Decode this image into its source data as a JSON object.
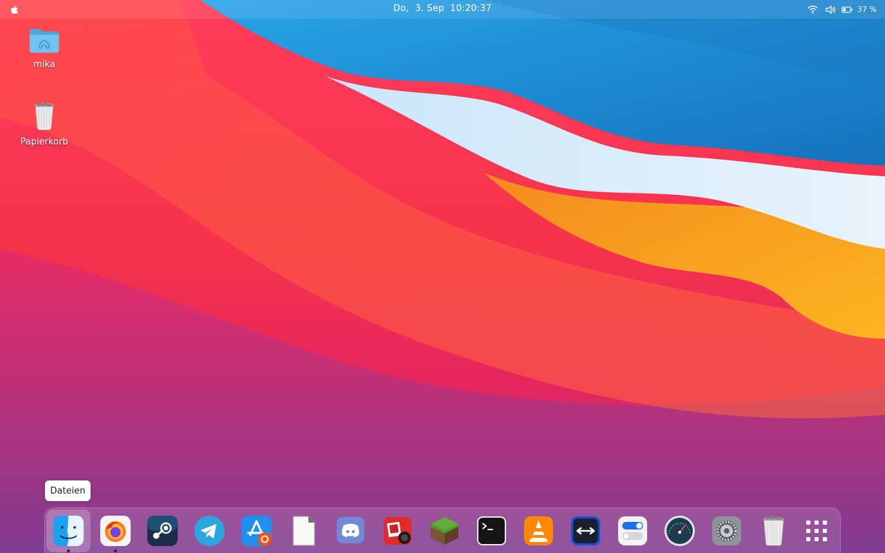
{
  "topbar": {
    "clock": "Do,  3. Sep  10:20:37",
    "battery_percent": "37 %"
  },
  "desktop": {
    "items": [
      {
        "label": "mika",
        "icon": "home-folder-icon"
      },
      {
        "label": "Papierkorb",
        "icon": "trash-icon"
      }
    ]
  },
  "dock": {
    "tooltip": "Dateien",
    "apps": [
      {
        "name": "finder",
        "icon": "finder-icon",
        "running": true,
        "active": true
      },
      {
        "name": "firefox",
        "icon": "firefox-icon",
        "running": true
      },
      {
        "name": "steam",
        "icon": "steam-icon"
      },
      {
        "name": "telegram",
        "icon": "telegram-icon"
      },
      {
        "name": "app-store",
        "icon": "app-store-icon"
      },
      {
        "name": "libreoffice",
        "icon": "document-icon"
      },
      {
        "name": "discord",
        "icon": "discord-icon"
      },
      {
        "name": "photo-booth",
        "icon": "photo-booth-icon"
      },
      {
        "name": "minecraft",
        "icon": "minecraft-icon"
      },
      {
        "name": "terminal",
        "icon": "terminal-icon"
      },
      {
        "name": "vlc",
        "icon": "vlc-icon"
      },
      {
        "name": "teamviewer",
        "icon": "teamviewer-icon"
      },
      {
        "name": "tweaks",
        "icon": "toggles-icon"
      },
      {
        "name": "stacer",
        "icon": "stacer-icon"
      },
      {
        "name": "settings",
        "icon": "settings-gear-icon"
      },
      {
        "name": "trash",
        "icon": "trash-icon"
      },
      {
        "name": "app-grid",
        "icon": "app-grid-icon"
      }
    ]
  },
  "colors": {
    "wallpaper_red": "#f23a4f",
    "wallpaper_blue": "#1e8fd8",
    "wallpaper_orange": "#f9a21a",
    "wallpaper_purple": "#7b3f9e"
  }
}
